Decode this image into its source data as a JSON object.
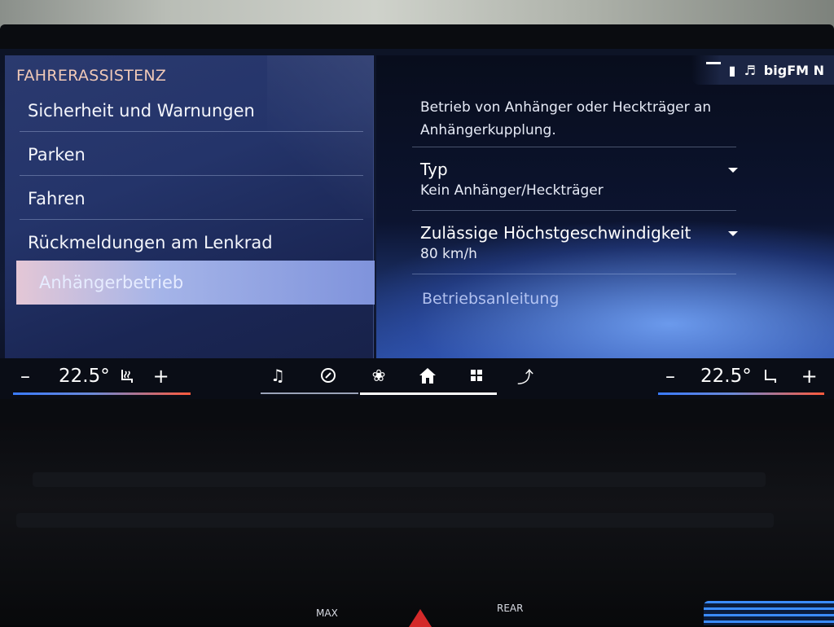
{
  "left_menu": {
    "section_title": "FAHRERASSISTENZ",
    "items": [
      {
        "label": "Sicherheit und Warnungen"
      },
      {
        "label": "Parken"
      },
      {
        "label": "Fahren"
      },
      {
        "label": "Rückmeldungen am Lenkrad"
      },
      {
        "label": "Anhängerbetrieb",
        "active": true
      }
    ]
  },
  "status": {
    "radio_station": "bigFM N"
  },
  "right_panel": {
    "description": "Betrieb von Anhänger oder Heckträger an Anhängerkupplung.",
    "settings": [
      {
        "label": "Typ",
        "value": "Kein Anhänger/Heckträger"
      },
      {
        "label": "Zulässige Höchstgeschwindigkeit",
        "value": "80 km/h"
      }
    ],
    "link_label": "Betriebsanleitung"
  },
  "climate": {
    "left": {
      "minus": "–",
      "temp": "22.5°",
      "plus": "+"
    },
    "right": {
      "minus": "–",
      "temp": "22.5°",
      "plus": "+"
    }
  },
  "nav_icons": [
    "music-icon",
    "navigation-icon",
    "fan-icon",
    "home-icon",
    "apps-icon",
    "phone-icon"
  ],
  "dash": {
    "max_label": "MAX",
    "rear_label": "REAR"
  }
}
